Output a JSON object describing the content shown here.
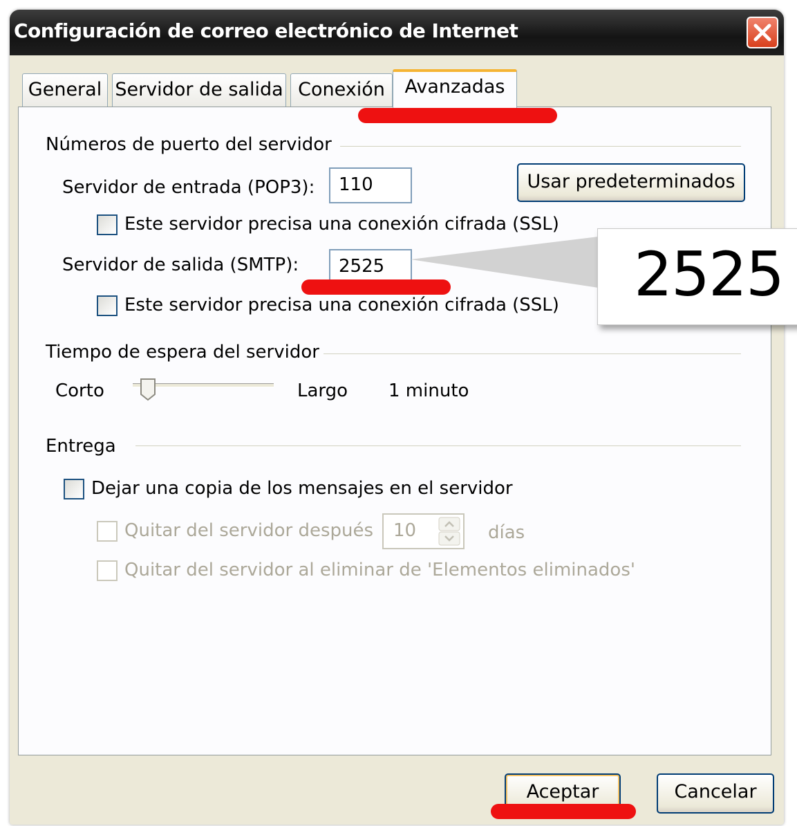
{
  "window": {
    "title": "Configuración de correo electrónico de Internet"
  },
  "tabs": [
    {
      "label": "General"
    },
    {
      "label": "Servidor de salida"
    },
    {
      "label": "Conexión"
    },
    {
      "label": "Avanzadas"
    }
  ],
  "ports": {
    "section": "Números de puerto del servidor",
    "incoming_label": "Servidor de entrada (POP3):",
    "incoming_value": "110",
    "defaults_button": "Usar predeterminados",
    "ssl_label_in": "Este servidor precisa una conexión cifrada (SSL)",
    "outgoing_label": "Servidor de salida (SMTP):",
    "outgoing_value": "2525",
    "ssl_label_out": "Este servidor precisa una conexión cifrada (SSL)"
  },
  "timeout": {
    "section": "Tiempo de espera del servidor",
    "short_label": "Corto",
    "long_label": "Largo",
    "value_text": "1 minuto",
    "slider_level": 0.1
  },
  "delivery": {
    "section": "Entrega",
    "leave_copy_label": "Dejar una copia de los mensajes en el servidor",
    "remove_after_label": "Quitar del servidor después",
    "days_value": "10",
    "days_label": "días",
    "remove_deleted_label": "Quitar del servidor al eliminar de 'Elementos eliminados'"
  },
  "footer": {
    "ok_label": "Aceptar",
    "cancel_label": "Cancelar"
  },
  "callout": {
    "text": "2525"
  },
  "colors": {
    "highlight": "#ee1111",
    "active_tab_accent": "#f5b434"
  }
}
